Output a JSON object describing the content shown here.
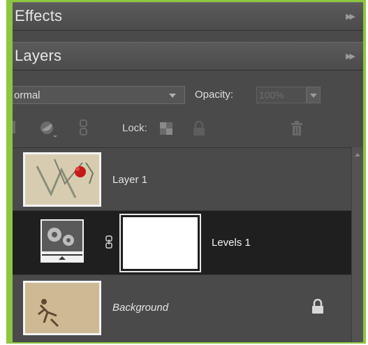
{
  "panels": {
    "effects": {
      "title": "Effects"
    },
    "layers": {
      "title": "Layers"
    }
  },
  "toolbar": {
    "blend_mode": "ormal",
    "opacity_label": "Opacity:",
    "opacity_value": "100%",
    "lock_label": "Lock:"
  },
  "layers": [
    {
      "name": "Layer 1",
      "selected": false,
      "type": "image"
    },
    {
      "name": "Levels 1",
      "selected": true,
      "type": "adjustment"
    },
    {
      "name": "Background",
      "selected": false,
      "type": "background",
      "locked": true
    }
  ],
  "icons": {
    "expand": "double-chevron-right-icon",
    "lock": "lock-icon",
    "trash": "trash-icon",
    "link": "link-icon",
    "adjustment": "gears-icon"
  },
  "colors": {
    "accent_border": "#8dc63f",
    "panel_bg": "#4a4a4a",
    "selected_row": "#1f1f1f"
  }
}
